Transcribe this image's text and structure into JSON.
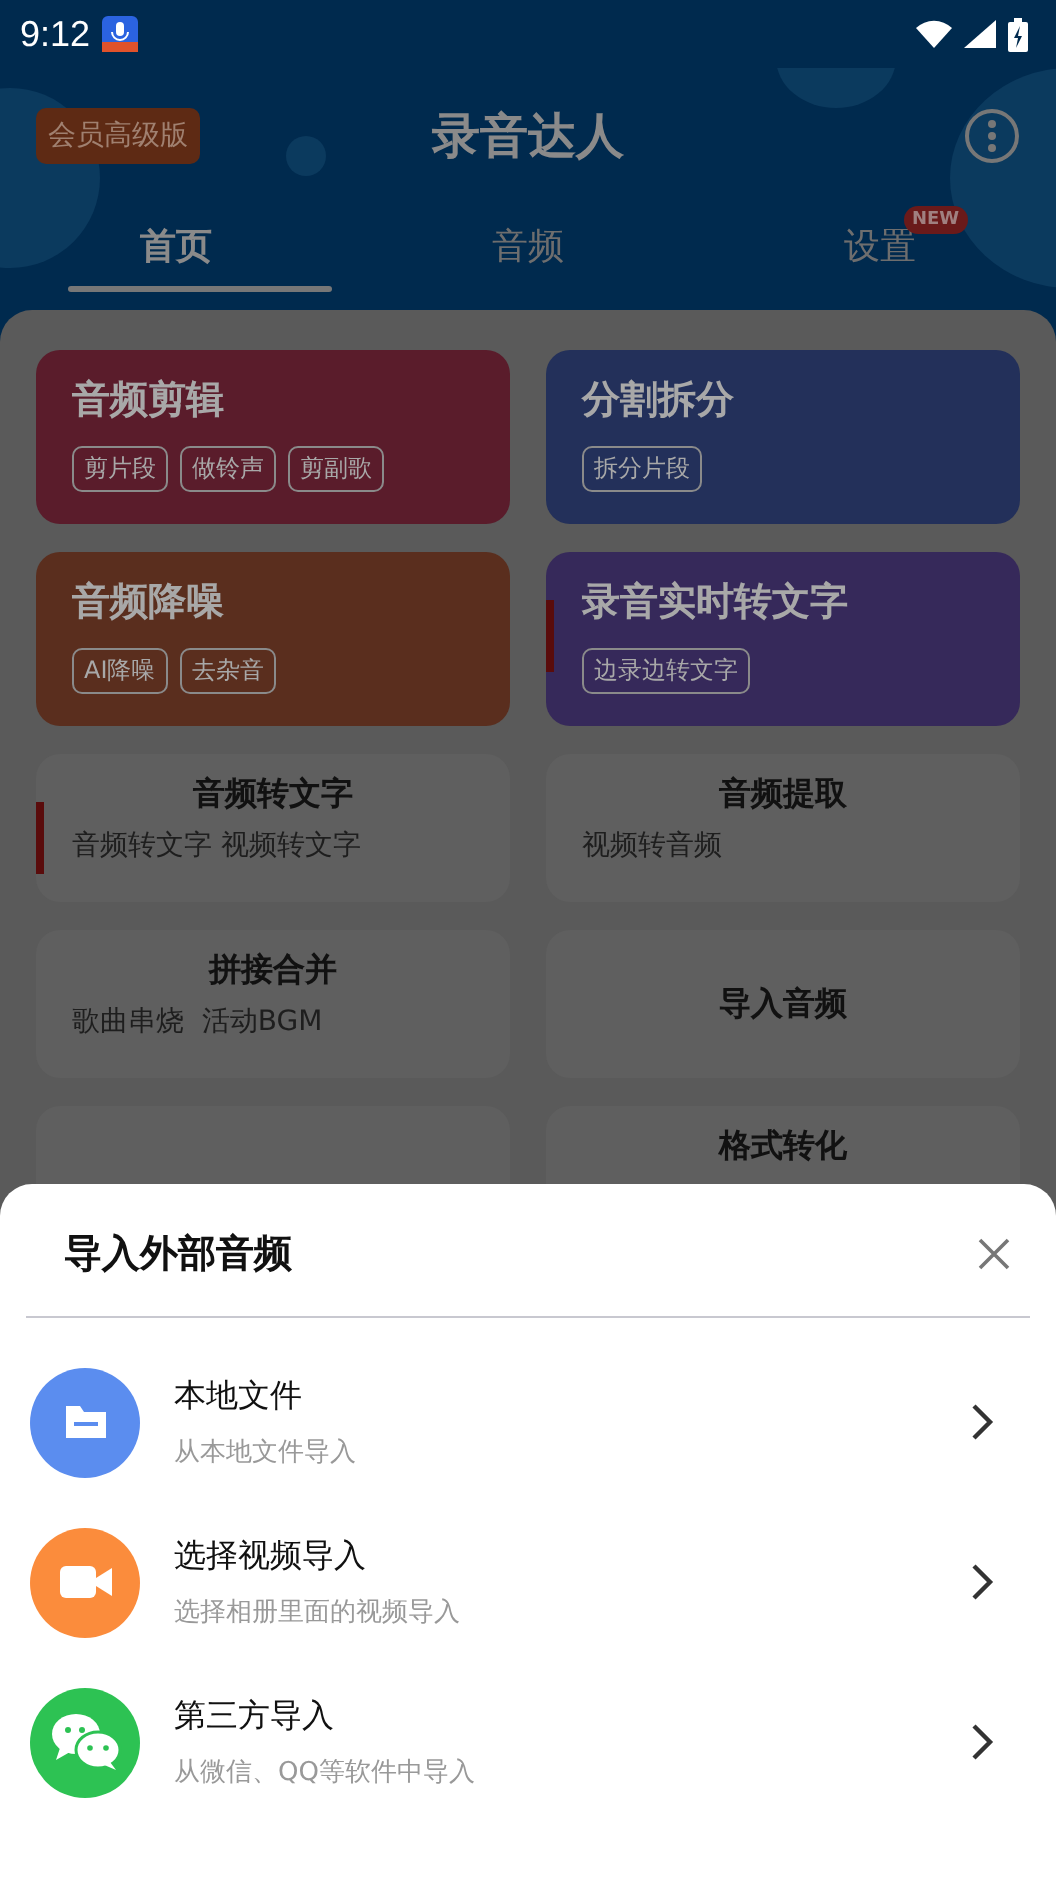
{
  "status_bar": {
    "time": "9:12"
  },
  "header": {
    "badge": "会员高级版",
    "title": "录音达人"
  },
  "tabs": [
    {
      "label": "首页",
      "selected": true
    },
    {
      "label": "音频",
      "selected": false
    },
    {
      "label": "设置",
      "selected": false,
      "badge": "NEW"
    }
  ],
  "feature_cards": [
    {
      "title": "音频剪辑",
      "tags": [
        "剪片段",
        "做铃声",
        "剪副歌"
      ],
      "color": "#5a1c2b"
    },
    {
      "title": "分割拆分",
      "tags": [
        "拆分片段"
      ],
      "color": "#23305a"
    },
    {
      "title": "音频降噪",
      "tags": [
        "AI降噪",
        "去杂音"
      ],
      "color": "#5a2e1e"
    },
    {
      "title": "录音实时转文字",
      "tags": [
        "边录边转文字"
      ],
      "color": "#36295a"
    }
  ],
  "tool_cards": [
    {
      "kind": "tool",
      "title": "音频转文字",
      "subtitle": "音频转文字 视频转文字"
    },
    {
      "kind": "tool",
      "title": "音频提取",
      "subtitle": "视频转音频"
    },
    {
      "kind": "tool",
      "title": "拼接合并",
      "subtitle": "歌曲串烧  活动BGM"
    },
    {
      "kind": "tool",
      "title": "导入音频"
    },
    {
      "kind": "blank"
    },
    {
      "kind": "tool",
      "title": "格式转化"
    }
  ],
  "sheet": {
    "title": "导入外部音频",
    "options": [
      {
        "kind": "folder",
        "title": "本地文件",
        "subtitle": "从本地文件导入",
        "color": "#5b8def"
      },
      {
        "kind": "video",
        "title": "选择视频导入",
        "subtitle": "选择相册里面的视频导入",
        "color": "#fb8c3c"
      },
      {
        "kind": "chat",
        "title": "第三方导入",
        "subtitle": "从微信、QQ等软件中导入",
        "color": "#2dc253"
      }
    ]
  }
}
